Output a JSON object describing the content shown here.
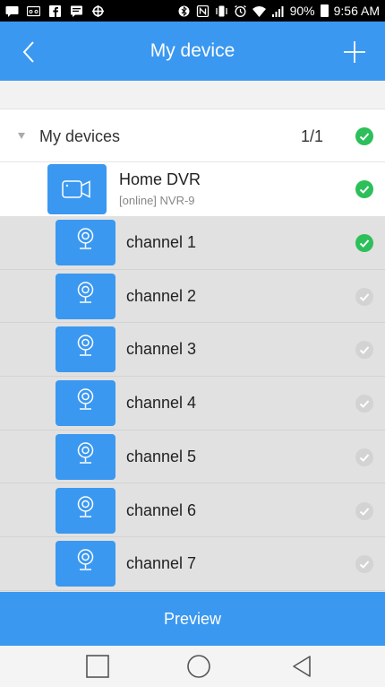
{
  "status_bar": {
    "battery": "90%",
    "time": "9:56 AM",
    "icons": [
      "message-icon",
      "voicemail-icon",
      "facebook-icon",
      "chat-icon",
      "settings-icon",
      "bluetooth-icon",
      "nfc-icon",
      "vibrate-icon",
      "alarm-icon",
      "wifi-icon",
      "signal-icon",
      "battery-icon"
    ]
  },
  "header": {
    "title": "My device",
    "back_icon": "chevron-left-icon",
    "add_icon": "plus-icon"
  },
  "group": {
    "label": "My devices",
    "count": "1/1",
    "selected": true
  },
  "device": {
    "name": "Home DVR",
    "status": "[online] NVR-9",
    "selected": true,
    "icon": "video-camera-icon"
  },
  "channels": [
    {
      "label": "channel 1",
      "selected": true
    },
    {
      "label": "channel 2",
      "selected": false
    },
    {
      "label": "channel 3",
      "selected": false
    },
    {
      "label": "channel 4",
      "selected": false
    },
    {
      "label": "channel 5",
      "selected": false
    },
    {
      "label": "channel 6",
      "selected": false
    },
    {
      "label": "channel 7",
      "selected": false
    }
  ],
  "footer": {
    "preview_label": "Preview"
  },
  "colors": {
    "accent": "#3a98f0",
    "check_on": "#2dbf5a",
    "check_off": "#d3d3d3"
  }
}
